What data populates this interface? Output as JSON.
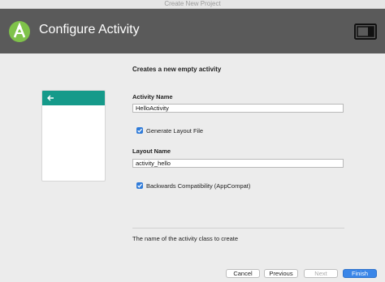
{
  "window": {
    "title": "Create New Project"
  },
  "header": {
    "title": "Configure Activity",
    "logo_icon": "android-studio-icon",
    "device_icon": "tablet-phone-icon"
  },
  "preview": {
    "back_icon": "arrow-back-icon",
    "appbar_color": "#159a8a"
  },
  "form": {
    "heading": "Creates a new empty activity",
    "activity_name_label": "Activity Name",
    "activity_name_value": "HelloActivity",
    "generate_layout_label": "Generate Layout File",
    "generate_layout_checked": true,
    "layout_name_label": "Layout Name",
    "layout_name_value": "activity_hello",
    "backwards_compat_label": "Backwards Compatibility (AppCompat)",
    "backwards_compat_checked": true,
    "hint": "The name of the activity class to create"
  },
  "buttons": {
    "cancel": "Cancel",
    "previous": "Previous",
    "next": "Next",
    "finish": "Finish"
  },
  "colors": {
    "header_bg": "#5a5a5a",
    "accent": "#3a86e8"
  }
}
